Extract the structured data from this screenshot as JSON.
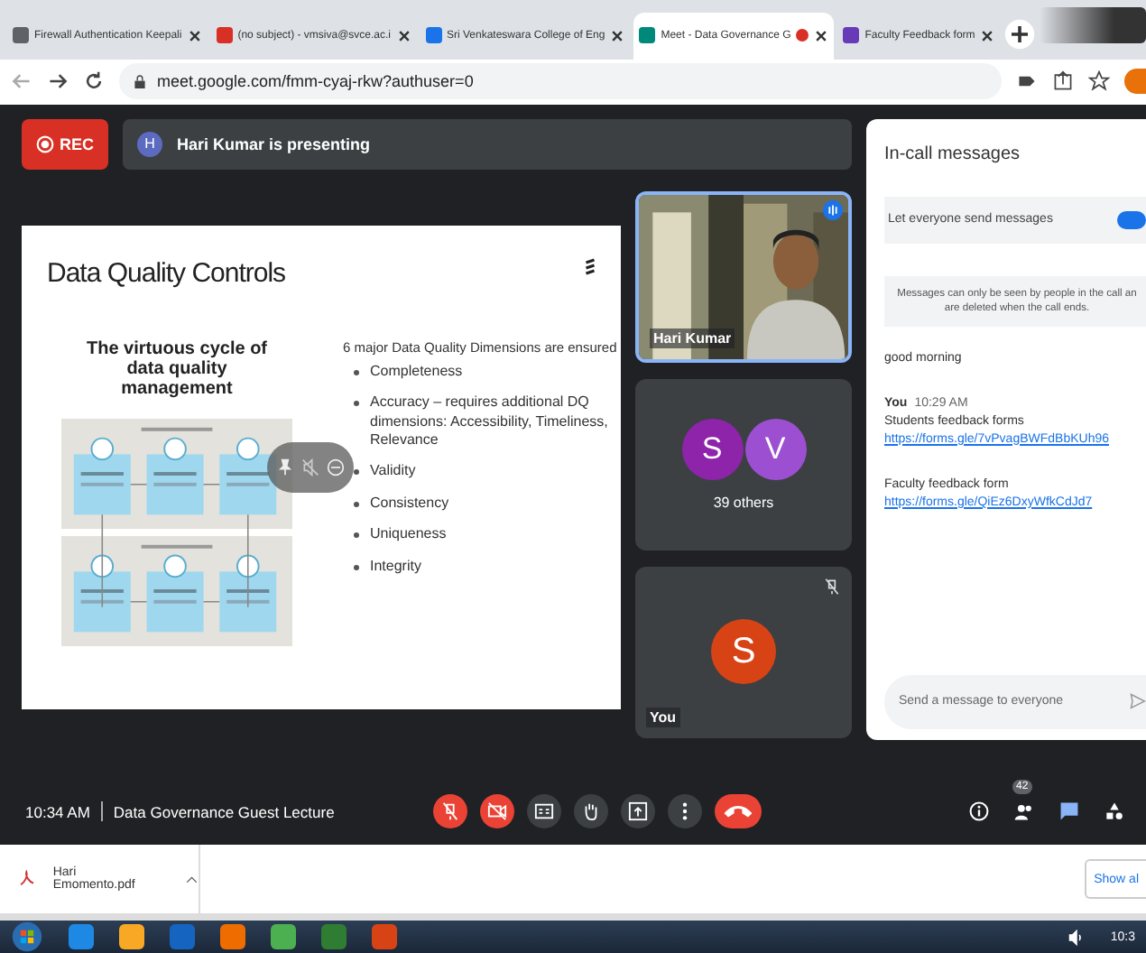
{
  "tabs": [
    {
      "label": "Firewall Authentication Keepali",
      "selected": false
    },
    {
      "label": "(no subject) - vmsiva@svce.ac.i",
      "selected": false
    },
    {
      "label": "Sri Venkateswara College of Eng",
      "selected": false
    },
    {
      "label": "Meet - Data Governance G",
      "selected": true,
      "recording": true
    },
    {
      "label": "Faculty Feedback form",
      "selected": false
    }
  ],
  "address": {
    "url": "meet.google.com/fmm-cyaj-rkw?authuser=0"
  },
  "meeting": {
    "rec": "REC",
    "presenter_initial": "H",
    "presenting": "Hari Kumar is presenting"
  },
  "slide": {
    "title": "Data Quality Controls",
    "diagram_title": "The virtuous cycle of data quality management",
    "intro": "6 major Data Quality Dimensions  are ensured",
    "bullets": [
      "Completeness",
      "Accuracy – requires additional DQ dimensions: Accessibility, Timeliness, Relevance",
      "Validity",
      "Consistency",
      "Uniqueness",
      "Integrity"
    ]
  },
  "tiles": [
    {
      "kind": "video",
      "name": "Hari Kumar",
      "speaking": true
    },
    {
      "kind": "group",
      "avatars": [
        {
          "initial": "S",
          "color": "#8e24aa"
        },
        {
          "initial": "V",
          "color": "#9c4fd0"
        }
      ],
      "label": "39 others"
    },
    {
      "kind": "self",
      "avatars": [
        {
          "initial": "S",
          "color": "#d84315"
        }
      ],
      "name": "You",
      "muted": true
    }
  ],
  "chat": {
    "title": "In-call messages",
    "setting": "Let everyone send messages",
    "setting_on": true,
    "notice_lines": [
      "Messages can only be seen by people in the call an",
      "are deleted when the call ends."
    ],
    "messages": [
      {
        "text": "good morning"
      },
      {
        "sender": "You",
        "time": "10:29 AM",
        "text": "Students feedback forms",
        "link": "https://forms.gle/7vPvagBWFdBbKUh96"
      },
      {
        "text": "Faculty feedback form",
        "link": "https://forms.gle/QiEz6DxyWfkCdJd7"
      }
    ],
    "placeholder": "Send a message to everyone"
  },
  "bottom_bar": {
    "time": "10:34 AM",
    "meeting_title": "Data Governance Guest Lecture",
    "controls": [
      {
        "kind": "mic",
        "muted": true
      },
      {
        "kind": "camera",
        "muted": true
      },
      {
        "kind": "captions"
      },
      {
        "kind": "hand"
      },
      {
        "kind": "present"
      },
      {
        "kind": "more"
      },
      {
        "kind": "end"
      }
    ],
    "participant_count": "42"
  },
  "downloads": {
    "file": "Hari Emomento.pdf",
    "show_all": "Show al"
  },
  "taskbar": {
    "clock": "10:3"
  }
}
